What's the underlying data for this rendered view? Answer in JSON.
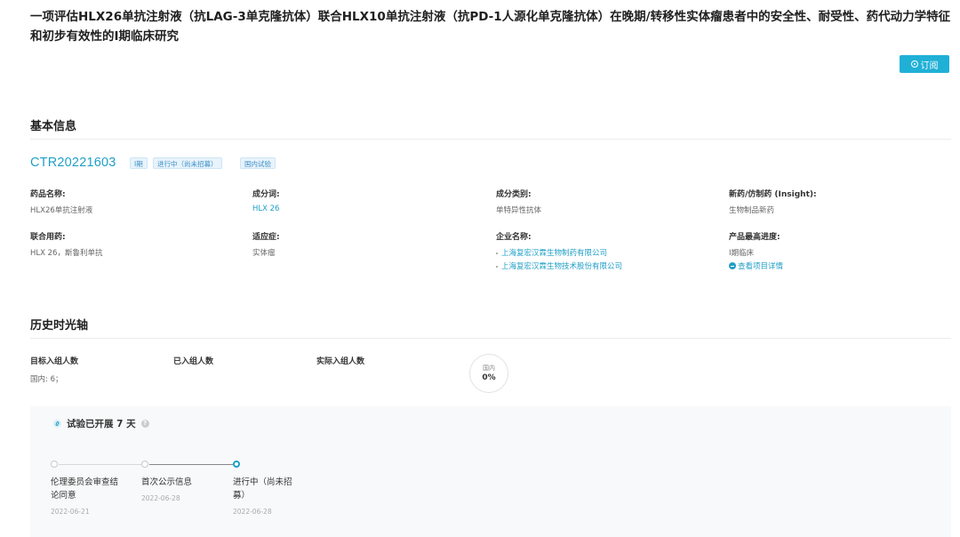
{
  "page_title": "一项评估HLX26单抗注射液（抗LAG-3单克隆抗体）联合HLX10单抗注射液（抗PD-1人源化单克隆抗体）在晚期/转移性实体瘤患者中的安全性、耐受性、药代动力学特征和初步有效性的I期临床研究",
  "subscribe_label": "订阅",
  "basic_info": {
    "heading": "基本信息",
    "ctr_id": "CTR20221603",
    "tags": [
      "I期",
      "进行中（尚未招募）",
      "国内试验"
    ],
    "fields": {
      "drug_name_label": "药品名称:",
      "drug_name_value": "HLX26单抗注射液",
      "ingredient_label": "成分词:",
      "ingredient_value": "HLX 26",
      "category_label": "成分类别:",
      "category_value": "单特异性抗体",
      "newdrug_label": "新药/仿制药 (Insight):",
      "newdrug_value": "生物制品新药",
      "combo_label": "联合用药:",
      "combo_value": "HLX 26，斯鲁利单抗",
      "indication_label": "适应症:",
      "indication_value": "实体瘤",
      "company_label": "企业名称:",
      "companies": [
        "上海复宏汉霖生物制药有限公司",
        "上海复宏汉霖生物技术股份有限公司"
      ],
      "progress_label": "产品最高进度:",
      "progress_value": "I期临床",
      "project_detail_link": "查看项目详情"
    }
  },
  "history": {
    "heading": "历史时光轴",
    "target_label": "目标入组人数",
    "target_value": "国内: 6；",
    "enrolled_label": "已入组人数",
    "actual_label": "实际入组人数",
    "pie_label": "国内",
    "pie_value": "0%",
    "pie_fraction": 0.0,
    "status_text": "试验已开展 7 天",
    "help_icon": "?",
    "timeline": [
      {
        "label": "伦理委员会审查结论同意",
        "date": "2022-06-21"
      },
      {
        "label": "首次公示信息",
        "date": "2022-06-28"
      },
      {
        "label": "进行中（尚未招募）",
        "date": "2022-06-28"
      }
    ]
  },
  "colors": {
    "accent": "#1f9fc7",
    "subscribe_bg": "#20b0d6"
  },
  "icons": [
    "subscribe-icon",
    "project-detail-icon",
    "status-icon",
    "help-icon"
  ]
}
